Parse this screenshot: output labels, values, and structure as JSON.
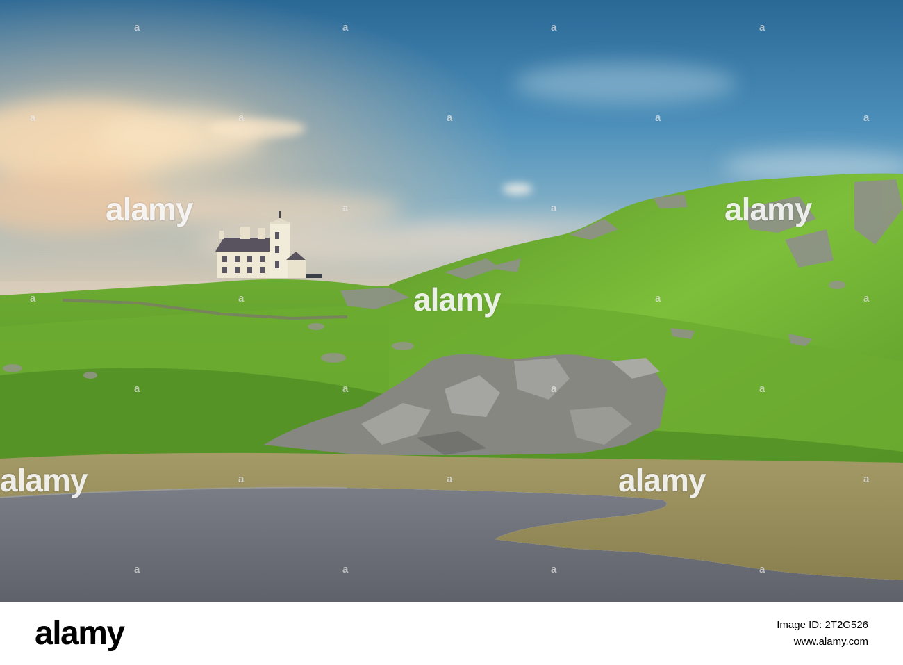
{
  "photo": {
    "subject": "white house on grassy hill above a loch",
    "colors": {
      "sky_top": "#2f6f9c",
      "sky_mid": "#5e9fc4",
      "sky_horizon": "#f0d2b0",
      "cloud_warm": "#f4d9b3",
      "grass_bright": "#7fc23a",
      "grass_dark": "#3f7a1c",
      "rock": "#8e8f88",
      "marsh": "#9a8f5e",
      "water": "#6f727a",
      "house": "#efe8d5",
      "roof": "#5a5560"
    }
  },
  "watermark": {
    "tile_text": "a",
    "logo_text": "alamy"
  },
  "footer": {
    "brand": "alamy",
    "image_id": "Image ID: 2T2G526",
    "url": "www.alamy.com"
  }
}
